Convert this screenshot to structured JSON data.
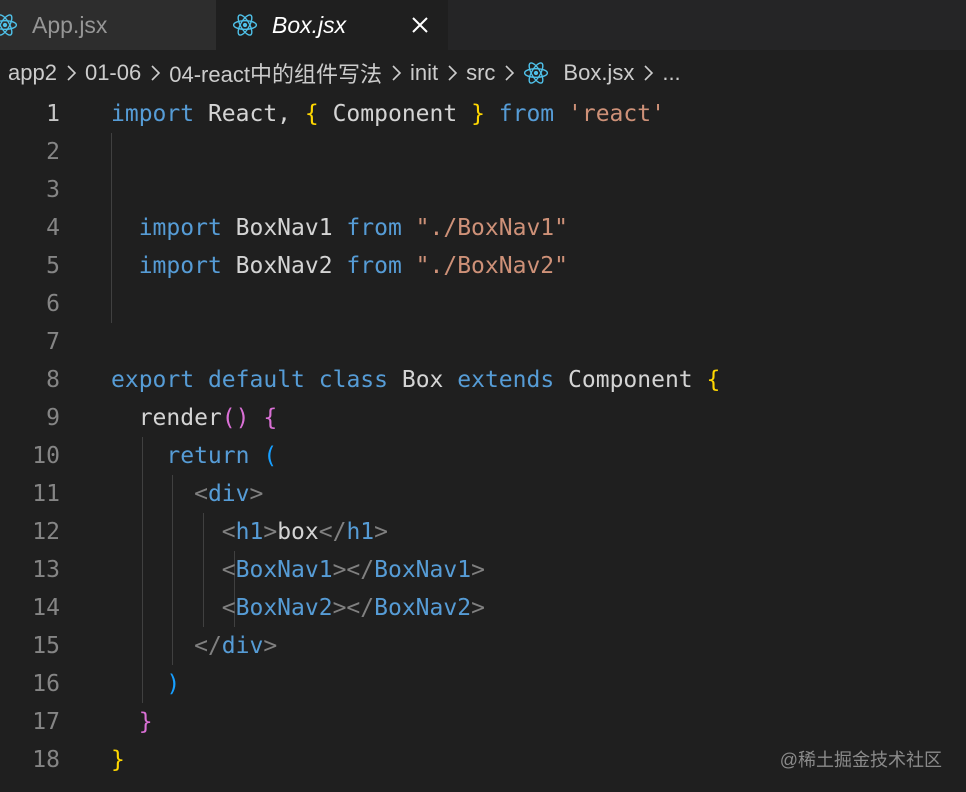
{
  "tabs": [
    {
      "label": "App.jsx",
      "icon": "react-icon",
      "active": false
    },
    {
      "label": "Box.jsx",
      "icon": "react-icon",
      "active": true
    }
  ],
  "breadcrumb": [
    "app2",
    "01-06",
    "04-react中的组件写法",
    "init",
    "src",
    "Box.jsx",
    "..."
  ],
  "editor": {
    "lines": [
      {
        "n": "1",
        "tokens": [
          [
            "import",
            "kw"
          ],
          [
            " React, ",
            "id"
          ],
          [
            "{",
            "b1"
          ],
          [
            " Component ",
            "id"
          ],
          [
            "}",
            "b1"
          ],
          [
            " from ",
            "kw"
          ],
          [
            "'react'",
            "str"
          ]
        ]
      },
      {
        "n": "2",
        "tokens": []
      },
      {
        "n": "3",
        "tokens": []
      },
      {
        "n": "4",
        "tokens": [
          [
            "  ",
            "id"
          ],
          [
            "import",
            "kw"
          ],
          [
            " BoxNav1 ",
            "id"
          ],
          [
            "from",
            "kw"
          ],
          [
            " ",
            "id"
          ],
          [
            "\"./BoxNav1\"",
            "str"
          ]
        ]
      },
      {
        "n": "5",
        "tokens": [
          [
            "  ",
            "id"
          ],
          [
            "import",
            "kw"
          ],
          [
            " BoxNav2 ",
            "id"
          ],
          [
            "from",
            "kw"
          ],
          [
            " ",
            "id"
          ],
          [
            "\"./BoxNav2\"",
            "str"
          ]
        ]
      },
      {
        "n": "6",
        "tokens": []
      },
      {
        "n": "7",
        "tokens": []
      },
      {
        "n": "8",
        "tokens": [
          [
            "export",
            "kw"
          ],
          [
            " ",
            "id"
          ],
          [
            "default",
            "kw"
          ],
          [
            " ",
            "id"
          ],
          [
            "class",
            "kw"
          ],
          [
            " Box ",
            "id"
          ],
          [
            "extends",
            "kw"
          ],
          [
            " Component ",
            "id"
          ],
          [
            "{",
            "b1"
          ]
        ]
      },
      {
        "n": "9",
        "tokens": [
          [
            "  render",
            "id"
          ],
          [
            "()",
            "b2"
          ],
          [
            " ",
            "id"
          ],
          [
            "{",
            "b2"
          ]
        ]
      },
      {
        "n": "10",
        "tokens": [
          [
            "    ",
            "id"
          ],
          [
            "return",
            "kw"
          ],
          [
            " ",
            "id"
          ],
          [
            "(",
            "b3"
          ]
        ]
      },
      {
        "n": "11",
        "tokens": [
          [
            "      ",
            "id"
          ],
          [
            "<",
            "punc"
          ],
          [
            "div",
            "tag"
          ],
          [
            ">",
            "punc"
          ]
        ]
      },
      {
        "n": "12",
        "tokens": [
          [
            "        ",
            "id"
          ],
          [
            "<",
            "punc"
          ],
          [
            "h1",
            "tag"
          ],
          [
            ">",
            "punc"
          ],
          [
            "box",
            "plain"
          ],
          [
            "</",
            "punc"
          ],
          [
            "h1",
            "tag"
          ],
          [
            ">",
            "punc"
          ]
        ]
      },
      {
        "n": "13",
        "tokens": [
          [
            "        ",
            "id"
          ],
          [
            "<",
            "punc"
          ],
          [
            "BoxNav1",
            "tag"
          ],
          [
            "></",
            "punc"
          ],
          [
            "BoxNav1",
            "tag"
          ],
          [
            ">",
            "punc"
          ]
        ]
      },
      {
        "n": "14",
        "tokens": [
          [
            "        ",
            "id"
          ],
          [
            "<",
            "punc"
          ],
          [
            "BoxNav2",
            "tag"
          ],
          [
            "></",
            "punc"
          ],
          [
            "BoxNav2",
            "tag"
          ],
          [
            ">",
            "punc"
          ]
        ]
      },
      {
        "n": "15",
        "tokens": [
          [
            "      ",
            "id"
          ],
          [
            "</",
            "punc"
          ],
          [
            "div",
            "tag"
          ],
          [
            ">",
            "punc"
          ]
        ]
      },
      {
        "n": "16",
        "tokens": [
          [
            "    ",
            "id"
          ],
          [
            ")",
            "b3"
          ]
        ]
      },
      {
        "n": "17",
        "tokens": [
          [
            "  ",
            "id"
          ],
          [
            "}",
            "b2"
          ]
        ]
      },
      {
        "n": "18",
        "tokens": [
          [
            "}",
            "b1"
          ]
        ]
      }
    ]
  },
  "watermark": "@稀土掘金技术社区"
}
